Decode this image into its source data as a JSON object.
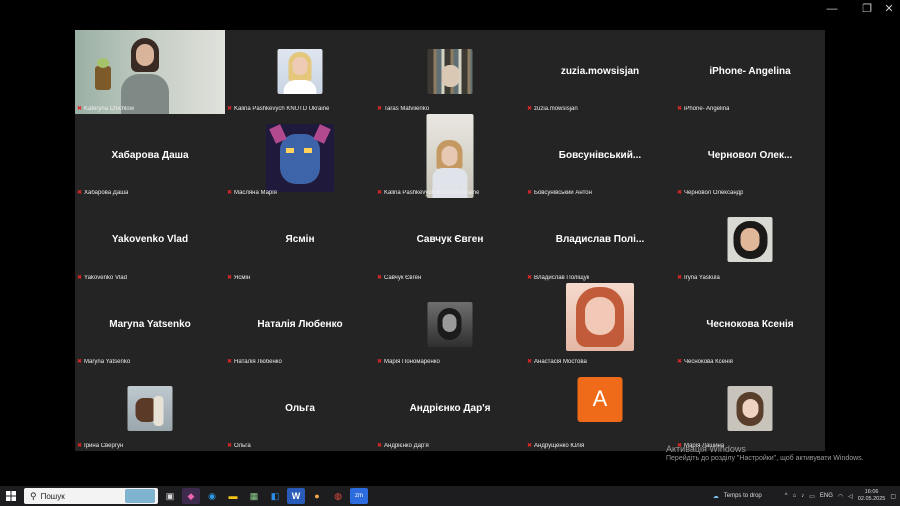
{
  "window": {
    "controls": [
      "—",
      "❐",
      "✕"
    ]
  },
  "participants": [
    {
      "label": "Kateryna Chichlow",
      "type": "video-woman",
      "active": true
    },
    {
      "label": "Kalina Pashkevych KNUTD Ukraine",
      "type": "photo-blonde"
    },
    {
      "label": "Taras Matviienko",
      "type": "photo-shelves"
    },
    {
      "label": "zuzia.mowsisjan",
      "big": "zuzia.mowsisjan"
    },
    {
      "label": "iPhone- Angelina",
      "big": "iPhone- Angelina"
    },
    {
      "label": "Хабарова Даша",
      "big": "Хабарова Даша"
    },
    {
      "label": "Масляна Марія",
      "type": "photo-anime"
    },
    {
      "label": "Kalina Pashkevych KNUTD Ukraine",
      "type": "photo-office"
    },
    {
      "label": "Бовсунівський Антон",
      "big": "Бовсунівський..."
    },
    {
      "label": "Черновол Олександр",
      "big": "Черновол Олек..."
    },
    {
      "label": "Yakovenko Vlad",
      "big": "Yakovenko Vlad"
    },
    {
      "label": "Ясмін",
      "big": "Ясмін"
    },
    {
      "label": "Савчук Євген",
      "big": "Савчук Євген"
    },
    {
      "label": "Владислав Поліщук",
      "big": "Владислав Полі..."
    },
    {
      "label": "Iryna Yaskula",
      "type": "photo-dark-hair"
    },
    {
      "label": "Maryna Yatsenko",
      "big": "Maryna Yatsenko"
    },
    {
      "label": "Наталія Любенко",
      "big": "Наталія Любенко"
    },
    {
      "label": "Марія Пономаренко",
      "type": "photo-bw"
    },
    {
      "label": "Анастасія Мостова",
      "type": "photo-redhead"
    },
    {
      "label": "Чеснокова Ксенія",
      "big": "Чеснокова Ксенія"
    },
    {
      "label": "Ірина Свергун",
      "type": "photo-horse"
    },
    {
      "label": "Ольга",
      "big": "Ольга"
    },
    {
      "label": "Андрієнко Дар'я",
      "big": "Андрієнко Дар'я"
    },
    {
      "label": "Андрущенко Юлія",
      "type": "letter",
      "letter": "A"
    },
    {
      "label": "Марія Лашина",
      "type": "photo-girl"
    }
  ],
  "watermark": {
    "line1": "Активація Windows",
    "line2": "Перейдіть до розділу \"Настройки\", щоб активувати Windows."
  },
  "taskbar": {
    "search_placeholder": "Пошук",
    "weather": "Temps to drop",
    "language": "ENG",
    "time": "16:06",
    "date": "02.05.2025"
  }
}
